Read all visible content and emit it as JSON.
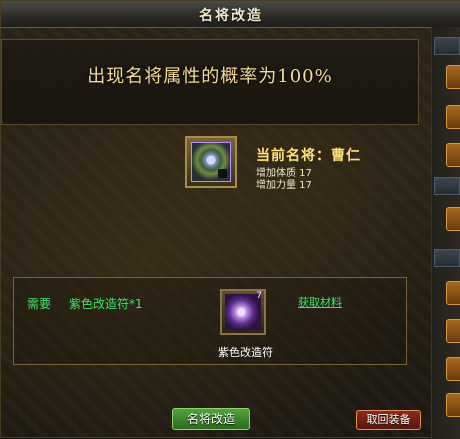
{
  "window": {
    "title": "名将改造"
  },
  "banner": {
    "probability_text": "出现名将属性的概率为100%"
  },
  "general": {
    "name_text": "当前名将：曹仁",
    "stats": [
      "增加体质 17",
      "增加力量 17"
    ],
    "icon": "general-portrait-icon"
  },
  "requirement": {
    "need_label": "需要",
    "item_text": "紫色改造符*1",
    "material_name": "紫色改造符",
    "material_icon": "purple-charm-icon",
    "material_count": "7",
    "get_link": "获取材料"
  },
  "buttons": {
    "improve": "名将改造",
    "back": "取回装备"
  },
  "colors": {
    "accent_green": "#3fe46a",
    "name_gold": "#ffe27a",
    "banner_text": "#f3d99a"
  }
}
